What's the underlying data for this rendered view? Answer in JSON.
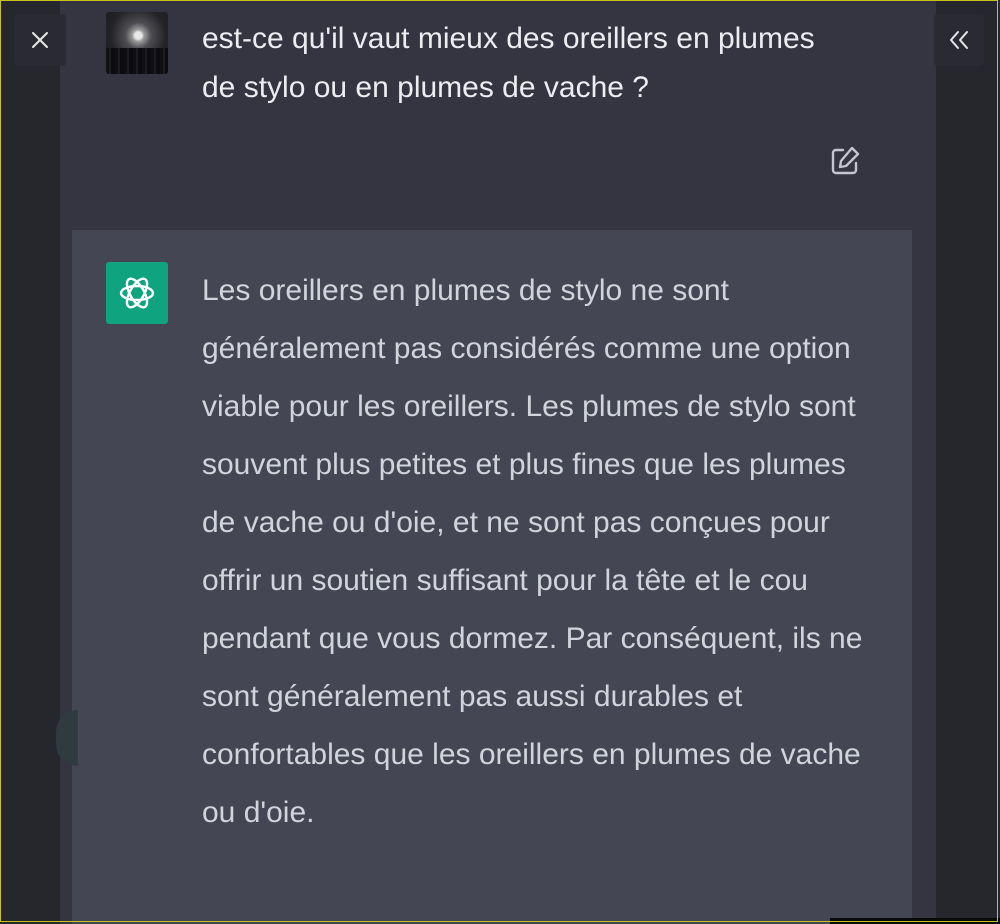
{
  "toolbar": {
    "close_icon": "close-icon",
    "collapse_icon": "double-chevron-left-icon"
  },
  "conversation": {
    "user_message": "est-ce qu'il vaut mieux des oreillers en plumes de stylo ou en plumes de vache ?",
    "assistant_message": "Les oreillers en plumes de stylo ne sont généralement pas considérés comme une option viable pour les oreillers. Les plumes de stylo sont souvent plus petites et plus fines que les plumes de vache ou d'oie, et ne sont pas conçues pour offrir un soutien suffisant pour la tête et le cou pendant que vous dormez. Par conséquent, ils ne sont généralement pas aussi durables et confortables que les oreillers en plumes de vache ou d'oie."
  },
  "icons": {
    "user_avatar": "user-avatar",
    "edit": "edit-icon",
    "assistant": "chatgpt-logo-icon"
  },
  "colors": {
    "assistant_accent": "#10a37f",
    "assistant_background": "#444654",
    "user_background": "#343541",
    "text_primary": "#ececf1",
    "text_secondary": "#d1d5db"
  }
}
